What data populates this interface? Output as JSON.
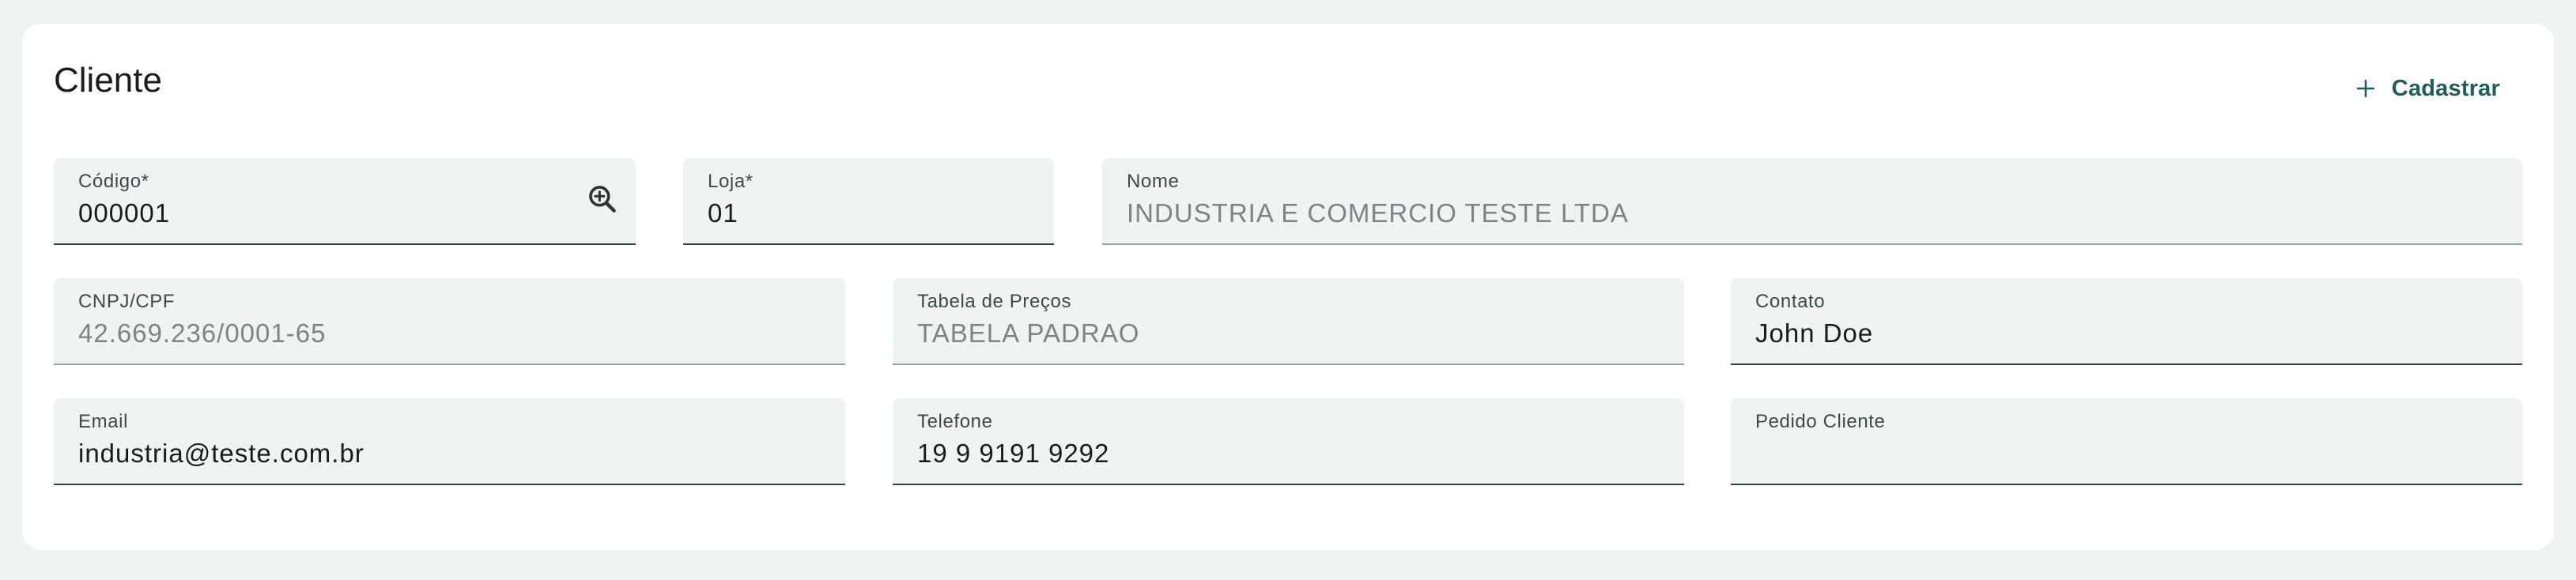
{
  "section": {
    "title": "Cliente",
    "add_button_label": "Cadastrar"
  },
  "fields": {
    "codigo": {
      "label": "Código*",
      "value": "000001"
    },
    "loja": {
      "label": "Loja*",
      "value": "01"
    },
    "nome": {
      "label": "Nome",
      "value": "INDUSTRIA E COMERCIO TESTE LTDA"
    },
    "cnpj": {
      "label": "CNPJ/CPF",
      "value": "42.669.236/0001-65"
    },
    "tabela_precos": {
      "label": "Tabela de Preços",
      "value": "TABELA PADRAO"
    },
    "contato": {
      "label": "Contato",
      "value": "John Doe"
    },
    "email": {
      "label": "Email",
      "value": "industria@teste.com.br"
    },
    "telefone": {
      "label": "Telefone",
      "value": "19 9 9191 9292"
    },
    "pedido_cliente": {
      "label": "Pedido Cliente",
      "value": ""
    }
  },
  "icons": {
    "add": "plus-icon",
    "lookup": "zoom-in-icon"
  },
  "colors": {
    "accent": "#1f5c5a",
    "field_bg": "#f1f3f2",
    "page_bg": "#f1f3f2",
    "card_bg": "#ffffff"
  }
}
